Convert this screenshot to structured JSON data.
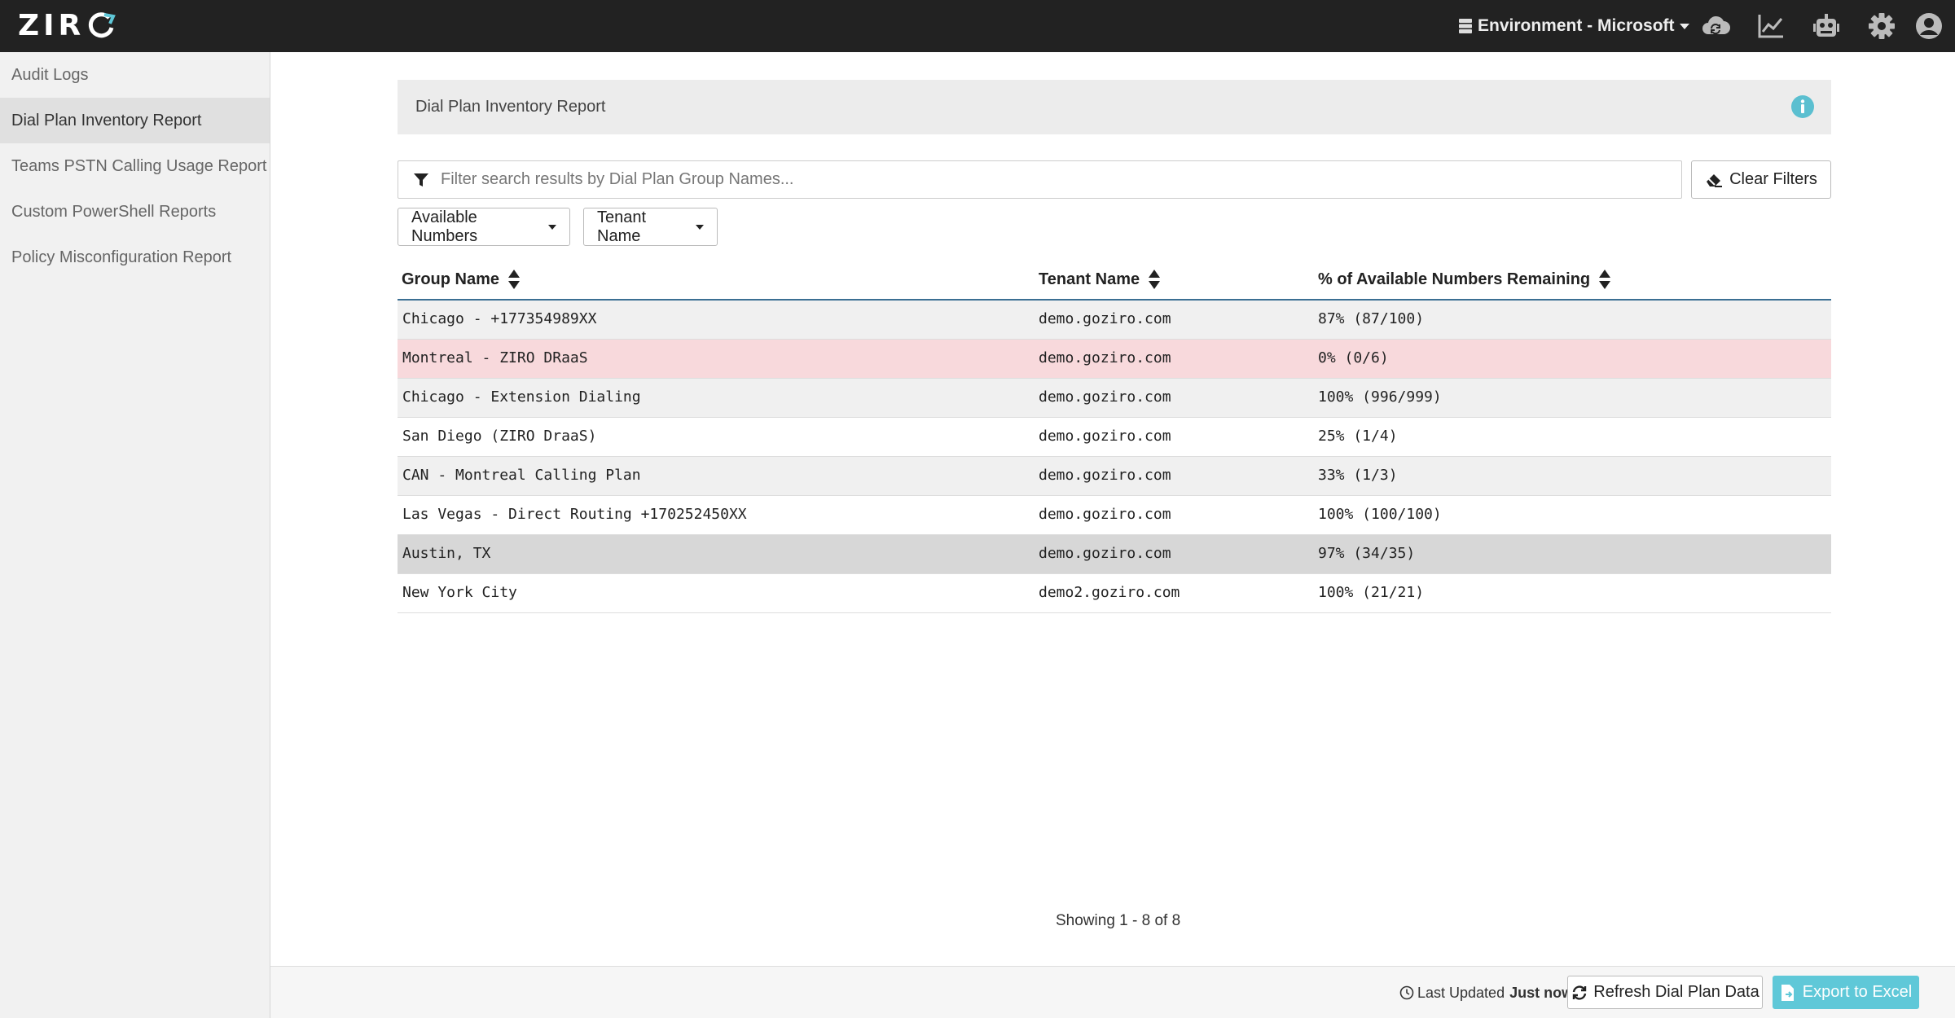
{
  "app": {
    "logo_text": "ZIR"
  },
  "topbar": {
    "environment_label": "Environment - Microsoft",
    "icons": [
      "cloud-sync-icon",
      "line-chart-icon",
      "robot-icon",
      "gear-icon",
      "user-avatar-icon"
    ]
  },
  "sidebar": {
    "items": [
      {
        "label": "Audit Logs",
        "active": false
      },
      {
        "label": "Dial Plan Inventory Report",
        "active": true
      },
      {
        "label": "Teams PSTN Calling Usage Report",
        "active": false
      },
      {
        "label": "Custom PowerShell Reports",
        "active": false
      },
      {
        "label": "Policy Misconfiguration Report",
        "active": false
      }
    ]
  },
  "main": {
    "title": "Dial Plan Inventory Report",
    "filter": {
      "placeholder": "Filter search results by Dial Plan Group Names...",
      "value": ""
    },
    "clear_filters_label": "Clear Filters",
    "dropdowns": {
      "available_numbers": "Available Numbers",
      "tenant_name": "Tenant Name"
    },
    "table": {
      "columns": [
        "Group Name",
        "Tenant Name",
        "% of Available Numbers Remaining"
      ],
      "rows": [
        {
          "group": "Chicago - +177354989XX",
          "tenant": "demo.goziro.com",
          "remaining": "87% (87/100)"
        },
        {
          "group": "Montreal - ZIRO DRaaS",
          "tenant": "demo.goziro.com",
          "remaining": "0% (0/6)"
        },
        {
          "group": "Chicago - Extension Dialing",
          "tenant": "demo.goziro.com",
          "remaining": "100% (996/999)"
        },
        {
          "group": "San Diego (ZIRO DraaS)",
          "tenant": "demo.goziro.com",
          "remaining": "25% (1/4)"
        },
        {
          "group": "CAN - Montreal Calling Plan",
          "tenant": "demo.goziro.com",
          "remaining": "33% (1/3)"
        },
        {
          "group": "Las Vegas - Direct Routing +170252450XX",
          "tenant": "demo.goziro.com",
          "remaining": "100% (100/100)"
        },
        {
          "group": "Austin, TX",
          "tenant": "demo.goziro.com",
          "remaining": "97% (34/35)"
        },
        {
          "group": "New York City",
          "tenant": "demo2.goziro.com",
          "remaining": "100% (21/21)"
        }
      ]
    },
    "pagination_text": "Showing 1 - 8 of 8"
  },
  "footer": {
    "last_updated_label": "Last Updated",
    "last_updated_value": "Just now",
    "refresh_label": "Refresh Dial Plan Data",
    "export_label": "Export to Excel"
  },
  "colors": {
    "topbar": "#222222",
    "accent": "#5fc8d8",
    "danger_row": "#f8d9dc",
    "header_rule": "#3b6f93",
    "info": "#5bbfd0"
  }
}
